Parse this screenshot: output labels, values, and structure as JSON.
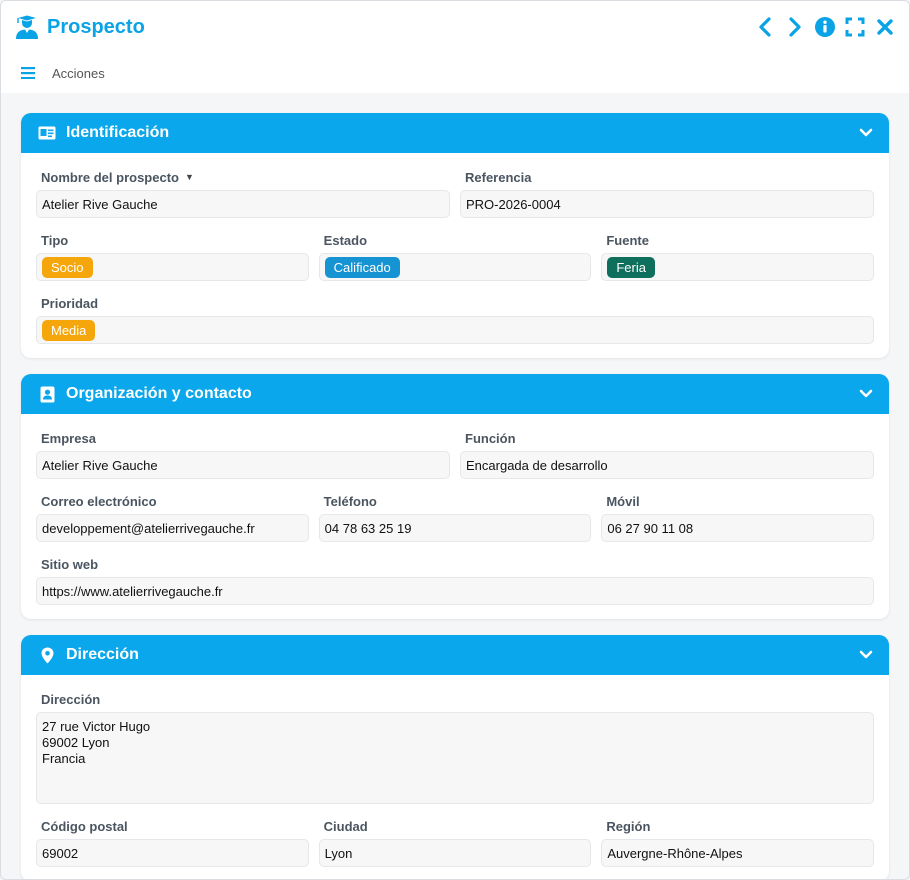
{
  "window": {
    "title": "Prospecto",
    "icons": [
      "student-icon",
      "chevron-left-icon",
      "chevron-right-icon",
      "info-icon",
      "fullscreen-icon",
      "close-icon"
    ]
  },
  "menubar": {
    "label": "Acciones",
    "icon": "hamburger-icon"
  },
  "colors": {
    "accent": "#0aa7ec",
    "orange": "#f5a60a",
    "blue": "#1593d3",
    "green": "#0e6f5c"
  },
  "panels": {
    "identificacion": {
      "title": "Identificación",
      "icon": "id-card-icon",
      "fields": {
        "nombre": {
          "label": "Nombre del prospecto",
          "value": "Atelier Rive Gauche"
        },
        "referencia": {
          "label": "Referencia",
          "value": "PRO-2026-0004"
        },
        "tipo": {
          "label": "Tipo",
          "value": "Socio"
        },
        "estado": {
          "label": "Estado",
          "value": "Calificado"
        },
        "fuente": {
          "label": "Fuente",
          "value": "Feria"
        },
        "prioridad": {
          "label": "Prioridad",
          "value": "Media"
        }
      }
    },
    "organizacion": {
      "title": "Organización y contacto",
      "icon": "contact-book-icon",
      "fields": {
        "empresa": {
          "label": "Empresa",
          "value": "Atelier Rive Gauche"
        },
        "funcion": {
          "label": "Función",
          "value": "Encargada de desarrollo"
        },
        "correo": {
          "label": "Correo electrónico",
          "value": "developpement@atelierrivegauche.fr"
        },
        "telefono": {
          "label": "Teléfono",
          "value": "04 78 63 25 19"
        },
        "movil": {
          "label": "Móvil",
          "value": "06 27 90 11 08"
        },
        "web": {
          "label": "Sitio web",
          "value": "https://www.atelierrivegauche.fr"
        }
      }
    },
    "direccion": {
      "title": "Dirección",
      "icon": "map-pin-icon",
      "fields": {
        "direccion": {
          "label": "Dirección",
          "value": "27 rue Victor Hugo\n69002 Lyon\nFrancia"
        },
        "cp": {
          "label": "Código postal",
          "value": "69002"
        },
        "ciudad": {
          "label": "Ciudad",
          "value": "Lyon"
        },
        "region": {
          "label": "Región",
          "value": "Auvergne-Rhône-Alpes"
        }
      }
    }
  }
}
